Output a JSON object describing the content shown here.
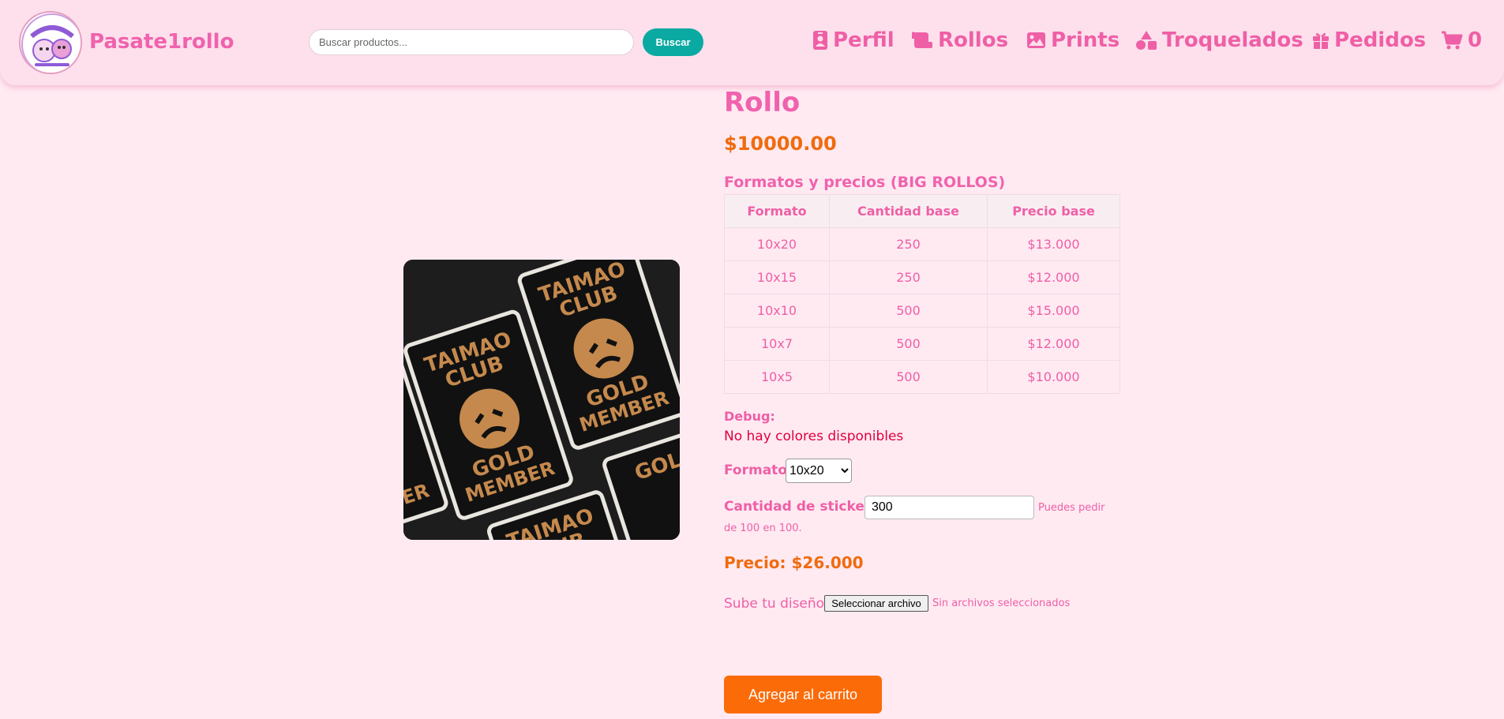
{
  "header": {
    "brand": "Pasate1rollo",
    "search": {
      "placeholder": "Buscar productos...",
      "value": "",
      "button_label": "Buscar"
    },
    "nav": [
      {
        "label": "Perfil",
        "icon": "id-badge-icon"
      },
      {
        "label": "Rollos",
        "icon": "scroll-icon"
      },
      {
        "label": "Prints",
        "icon": "image-icon"
      },
      {
        "label": "Troquelados",
        "icon": "shapes-icon"
      },
      {
        "label": "Pedidos",
        "icon": "gift-icon"
      }
    ],
    "cart": {
      "icon": "cart-icon",
      "count": "0"
    },
    "logo_text": [
      "PASATE 1 ROLLO"
    ]
  },
  "product": {
    "title": "Rollo",
    "price": "$10000.00",
    "image_text": [
      "TAIMAO",
      "CLUB",
      "GOLD",
      "MEMBER"
    ],
    "formats_title": "Formatos y precios (BIG ROLLOS)",
    "formats_table": {
      "headers": [
        "Formato",
        "Cantidad base",
        "Precio base"
      ],
      "rows": [
        [
          "10x20",
          "250",
          "$13.000"
        ],
        [
          "10x15",
          "250",
          "$12.000"
        ],
        [
          "10x10",
          "500",
          "$15.000"
        ],
        [
          "10x7",
          "500",
          "$12.000"
        ],
        [
          "10x5",
          "500",
          "$10.000"
        ]
      ]
    },
    "debug_label": "Debug:",
    "debug_message": "No hay colores disponibles",
    "format_label": "Formato:",
    "format_selected": "10x20",
    "quantity_label": "Cantidad de stickers:",
    "quantity_value": "300",
    "quantity_hint_part1": "Puedes pedir",
    "quantity_hint_part2": "de 100 en 100.",
    "total_price": "Precio: $26.000",
    "upload_label": "Sube tu diseño:",
    "upload_button": "Seleccionar archivo",
    "upload_status": "Sin archivos seleccionados",
    "add_to_cart": "Agregar al carrito"
  },
  "colors": {
    "pink": "#ef5fa6",
    "orange": "#f06b0f",
    "teal": "#0aa9a1",
    "background": "#ffeaf2",
    "header": "#fde0ec"
  }
}
